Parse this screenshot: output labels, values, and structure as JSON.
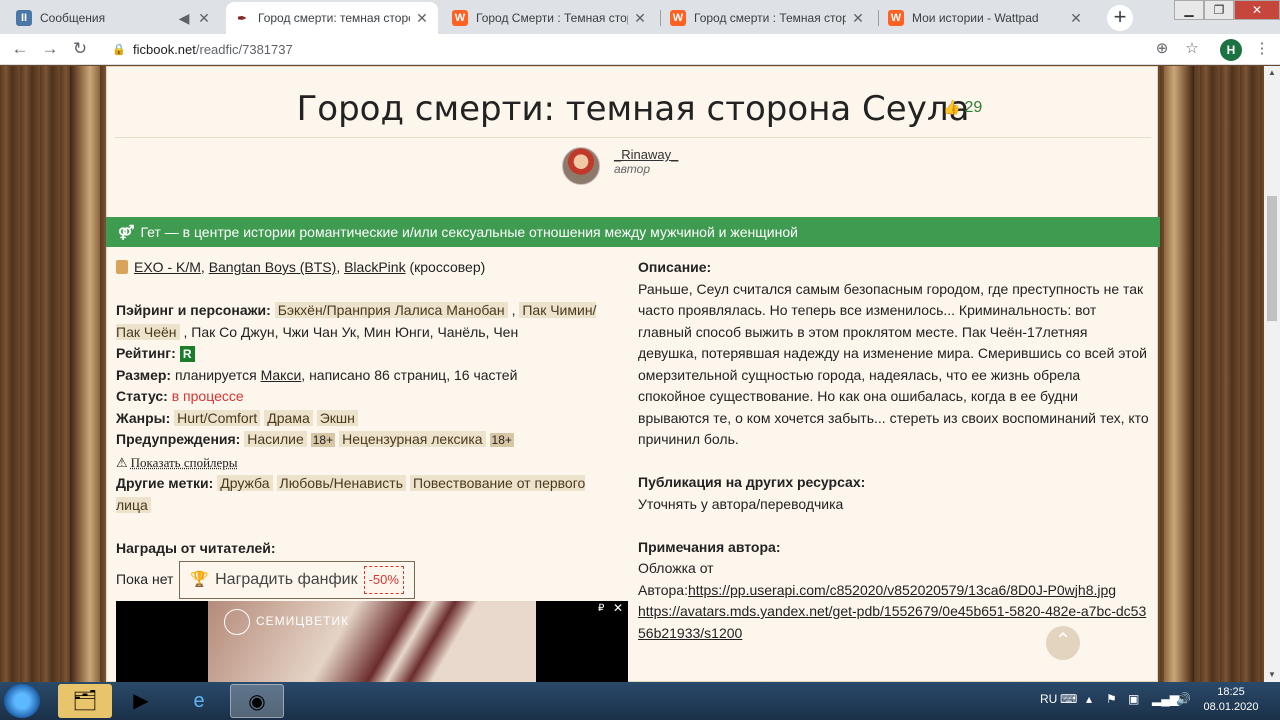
{
  "browser": {
    "tabs": [
      {
        "title": "Сообщения",
        "icon": "vk-icon",
        "color": "#4a76a8",
        "glyph": "II",
        "muted": true
      },
      {
        "title": "Город смерти: темная сторона",
        "icon": "ficbook-icon",
        "color": "#7a1f1f",
        "glyph": "✒",
        "active": true
      },
      {
        "title": "Город Смерти : Темная сторона",
        "icon": "wattpad-icon",
        "color": "#ff6122",
        "glyph": "W"
      },
      {
        "title": "Город смерти : Темная сторона",
        "icon": "wattpad-icon",
        "color": "#ff6122",
        "glyph": "W"
      },
      {
        "title": "Мои истории - Wattpad",
        "icon": "wattpad-icon",
        "color": "#ff6122",
        "glyph": "W"
      }
    ],
    "url_host": "ficbook.net",
    "url_path": "/readfic/7381737",
    "profile_initial": "Н"
  },
  "fic": {
    "title": "Город смерти: темная сторона Сеула",
    "likes": "29",
    "author": " _Rinaway_ ",
    "author_role": "автор",
    "direction": "Гет — в центре истории романтические и/или сексуальные отношения между мужчиной и женщиной",
    "fandoms": [
      "EXO - K/M",
      "Bangtan Boys (BTS)",
      "BlackPink"
    ],
    "fandom_note": "(кроссовер)",
    "pairing_label": "Пэйринг и персонажи:",
    "pairings": [
      "Бэкхён/Пранприя Лалиса Манобан",
      "Пак Чимин/Пак Чеён"
    ],
    "characters": "Пак Со Джун, Чжи Чан Ук, Мин Юнги, Чанёль, Чен",
    "rating_label": "Рейтинг:",
    "rating": "R",
    "size_label": "Размер:",
    "size_pre": "планируется",
    "size_link": "Макси",
    "size_post": ", написано 86 страниц, 16 частей",
    "status_label": "Статус:",
    "status": "в процессе",
    "genres_label": "Жанры:",
    "genres": [
      "Hurt/Comfort",
      "Драма",
      "Экшн"
    ],
    "warnings_label": "Предупреждения:",
    "warnings": [
      {
        "name": "Насилие",
        "age": "18+"
      },
      {
        "name": "Нецензурная лексика",
        "age": "18+"
      }
    ],
    "show_spoilers": "Показать спойлеры",
    "other_tags_label": "Другие метки:",
    "other_tags": [
      "Дружба",
      "Любовь/Ненависть",
      "Повествование от первого лица"
    ],
    "awards_label": "Награды от читателей:",
    "awards_none": "Пока нет",
    "award_button": "Наградить фанфик",
    "award_discount": "-50%",
    "description_label": "Описание:",
    "description": "Раньше, Сеул считался самым безопасным городом, где преступность не так часто проявлялась. Но теперь все изменилось... Криминальность: вот главный способ выжить в этом проклятом месте. Пак Чеён-17летняя девушка, потерявшая надежду на изменение мира. Смерившись со всей этой омерзительной сущностью города, надеялась, что ее жизнь обрела спокойное существование. Но как она ошибалась, когда в ее будни врываются те, о ком хочется забыть... стереть из своих воспоминаний тех, кто причинил боль.",
    "publication_label": "Публикация на других ресурсах:",
    "publication": "Уточнять у автора/переводчика",
    "notes_label": "Примечания автора:",
    "notes_text": "Обложка от",
    "notes_prefix": "Автора:",
    "notes_link1": "https://pp.userapi.com/c852020/v852020579/13ca6/8D0J-P0wjh8.jpg",
    "notes_link2": "https://avatars.mds.yandex.net/get-pdb/1552679/0e45b651-5820-482e-a7bc-dc5356b21933/s1200"
  },
  "ad": {
    "brand": "СЕМИЦВЕТИК",
    "mark": "₽",
    "close": "✕"
  },
  "taskbar": {
    "lang": "RU",
    "time": "18:25",
    "date": "08.01.2020"
  }
}
